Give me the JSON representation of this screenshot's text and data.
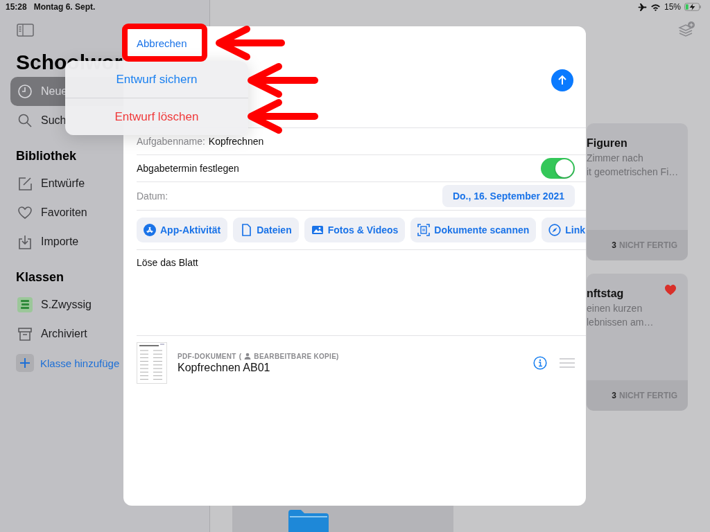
{
  "status_bar": {
    "time": "15:28",
    "date": "Montag 6. Sept.",
    "battery": "15%"
  },
  "sidebar": {
    "title": "Schoolwor",
    "top_items": [
      {
        "label": "Neue",
        "kind": "clock",
        "selected": true
      },
      {
        "label": "Such",
        "kind": "search",
        "selected": false
      }
    ],
    "sections": [
      {
        "title": "Bibliothek",
        "items": [
          {
            "label": "Entwürfe",
            "kind": "edit"
          },
          {
            "label": "Favoriten",
            "kind": "heart"
          },
          {
            "label": "Importe",
            "kind": "import"
          }
        ]
      },
      {
        "title": "Klassen",
        "items": [
          {
            "label": "S.Zwyssig",
            "kind": "class"
          },
          {
            "label": "Archiviert",
            "kind": "archive"
          }
        ]
      }
    ],
    "add_button": "Klasse hinzufüge"
  },
  "cards": [
    {
      "title": "Figuren",
      "lines": [
        "Zimmer nach",
        "it geometrischen Fi…"
      ],
      "count": "3",
      "status": "NICHT FERTIG",
      "favorite": false
    },
    {
      "title": "nftstag",
      "lines": [
        "einen kurzen",
        "lebnissen am…"
      ],
      "count": "3",
      "status": "NICHT FERTIG",
      "favorite": true
    }
  ],
  "modal": {
    "cancel": "Abbrechen",
    "name_field": {
      "label": "Aufgabenname:",
      "value": "Kopfrechnen"
    },
    "due_toggle": {
      "label": "Abgabetermin festlegen",
      "on": true
    },
    "date": {
      "label": "Datum:",
      "value": "Do., 16. September 2021"
    },
    "attachment_buttons": [
      {
        "label": "App-Aktivität",
        "kind": "appstore"
      },
      {
        "label": "Dateien",
        "kind": "file"
      },
      {
        "label": "Fotos & Videos",
        "kind": "photo"
      },
      {
        "label": "Dokumente scannen",
        "kind": "scan"
      },
      {
        "label": "Link",
        "kind": "compass"
      }
    ],
    "instructions": "Löse das Blatt",
    "attachment": {
      "type": "PDF-DOKUMENT",
      "access_open": "(",
      "access": "BEARBEITBARE KOPIE)",
      "name": "Kopfrechnen AB01"
    }
  },
  "popover": {
    "items": [
      {
        "label": "Entwurf sichern",
        "kind": "default"
      },
      {
        "label": "Entwurf löschen",
        "kind": "destructive"
      }
    ]
  }
}
